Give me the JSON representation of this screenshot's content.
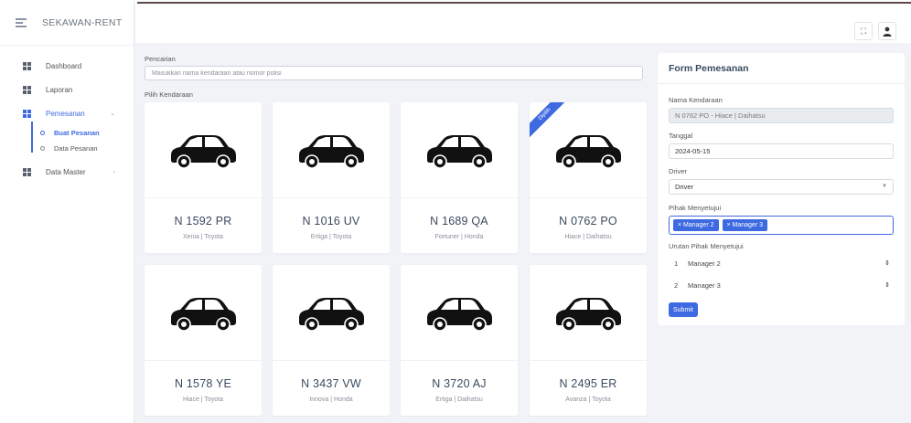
{
  "app": {
    "brand": "SEKAWAN-RENT"
  },
  "sidebar": {
    "items": [
      {
        "label": "Dashboard"
      },
      {
        "label": "Laporan"
      },
      {
        "label": "Pemesanan",
        "caret": "⌄"
      },
      {
        "label": "Data Master",
        "caret": "›"
      }
    ],
    "sub_items": [
      {
        "label": "Buat Pesanan"
      },
      {
        "label": "Data Pesanan"
      }
    ]
  },
  "header": {
    "fullscreen_icon": "⛶",
    "user_icon": "👤"
  },
  "search": {
    "label": "Pencarian",
    "placeholder": "Masukkan nama kendaraan atau nomor polisi",
    "vehicles_label": "Pilih Kendaraan"
  },
  "vehicles": [
    {
      "plate": "N 1592 PR",
      "type": "Xenia | Toyota"
    },
    {
      "plate": "N 1016 UV",
      "type": "Ertiga | Toyota"
    },
    {
      "plate": "N 1689 QA",
      "type": "Fortuner | Honda"
    },
    {
      "plate": "N 0762 PO",
      "type": "Hiace | Daihatsu",
      "ribbon": "Dipilih"
    },
    {
      "plate": "N 1578 YE",
      "type": "Hiace | Toyota"
    },
    {
      "plate": "N 3437 VW",
      "type": "Innova | Honda"
    },
    {
      "plate": "N 3720 AJ",
      "type": "Ertiga | Daihatsu"
    },
    {
      "plate": "N 2495 ER",
      "type": "Avanza | Toyota"
    }
  ],
  "form": {
    "title": "Form Pemesanan",
    "vehicle_label": "Nama Kendaraan",
    "vehicle_value": "N 0762 PO - Hiace | Daihatsu",
    "date_label": "Tanggal",
    "date_value": "2024-05-15",
    "driver_label": "Driver",
    "driver_value": "Driver",
    "approver_label": "Pihak Menyetujui",
    "approvers": [
      "× Manager 2",
      "× Manager 3"
    ],
    "order_label": "Urutan Pihak Menyetujui",
    "order": [
      {
        "num": "1",
        "name": "Manager 2"
      },
      {
        "num": "2",
        "name": "Manager 3"
      }
    ],
    "submit_label": "Submit"
  }
}
